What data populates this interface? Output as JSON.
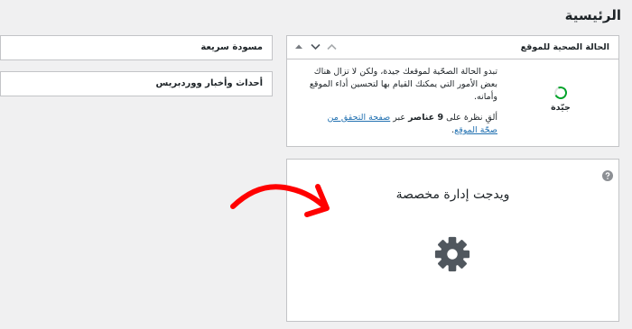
{
  "page": {
    "title": "الرئيسية"
  },
  "widgets": {
    "quick_draft": {
      "title": "مسودة سريعة"
    },
    "news": {
      "title": "أحداث وأخبار ووردبريس"
    }
  },
  "site_health": {
    "title": "الحالة الصحية للموقع",
    "status_label": "جيّدة",
    "description": "تبدو الحالة الصحّية لموقعك جيدة، ولكن لا تزال هناك بعض الأمور التي يمكنك القيام بها لتحسين أداء الموقع وأمانه.",
    "items_prefix": "ألقِ نظرة على",
    "items_count": "9 عناصر",
    "items_middle": "عبر",
    "link_text": "صفحة التحقق من صحّة الموقع",
    "items_suffix": "."
  },
  "custom_widget": {
    "title": "ويدجت إدارة مخصصة",
    "icon": "gear-icon",
    "help_icon": "help-icon"
  },
  "colors": {
    "status_good": "#00a32a",
    "link": "#2271b1",
    "arrow": "#ff0000"
  }
}
